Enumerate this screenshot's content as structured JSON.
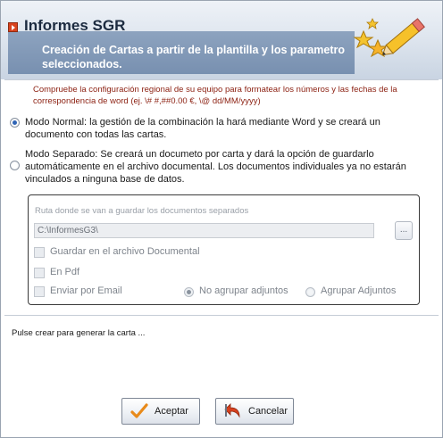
{
  "header": {
    "title": "Informes SGR",
    "subtitle": "Creación de Cartas a partir de la plantilla y los parametro seleccionados.",
    "decoration_icon": "stars-pencil-icon"
  },
  "notice": {
    "text": "Compruebe la configuración regional de su equipo para formatear los números y las fechas de la correspondencia de word (ej. \\# #,##0.00 €, \\@ dd/MM/yyyy)",
    "color": "#8b1f10"
  },
  "modes": {
    "normal": {
      "label": "Modo Normal: la gestión de la combinación la hará mediante Word y se creará un documento con todas las cartas.",
      "selected": true
    },
    "separado": {
      "label": "Modo Separado: Se creará un documeto por carta y dará la opción de guardarlo automáticamente en el archivo documental. Los documentos individuales ya no estarán vinculados a ninguna base de datos.",
      "selected": false
    }
  },
  "separate_options": {
    "path_label": "Ruta donde se van a guardar los documentos separados",
    "path_value": "C:\\InformesG3\\",
    "browse_label": "...",
    "save_archive": "Guardar en el archivo Documental",
    "pdf": "En Pdf",
    "email": "Enviar por Email",
    "no_group": "No agrupar adjuntos",
    "group": "Agrupar Adjuntos",
    "no_group_selected": true
  },
  "status": "Pulse crear para generar la carta ...",
  "buttons": {
    "accept": "Aceptar",
    "cancel": "Cancelar"
  },
  "colors": {
    "title_bullet": "#d9431e",
    "header_bar": "#7890b0",
    "radio_selected": "#2f64b5"
  }
}
